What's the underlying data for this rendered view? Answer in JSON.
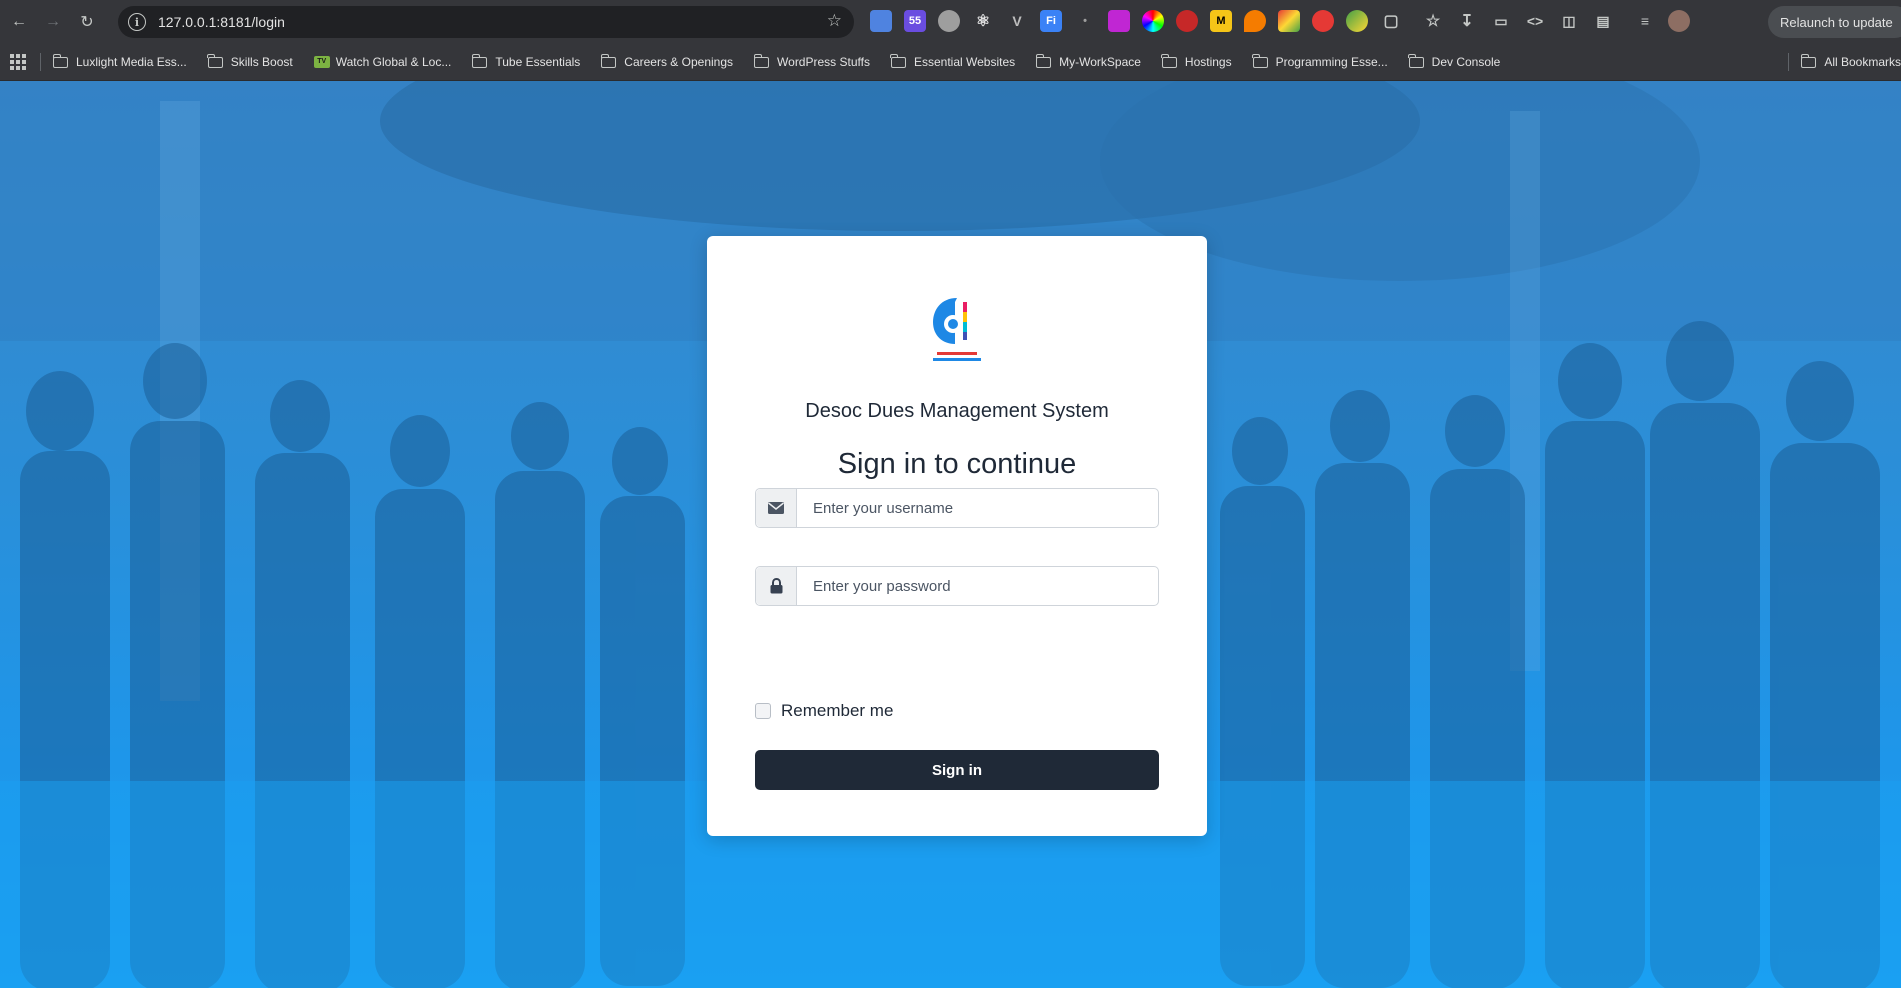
{
  "browser": {
    "url": "127.0.0.1:8181/login",
    "relaunch_label": "Relaunch to update",
    "extensions": [
      "doc-ext",
      "ss-ext",
      "ghost-ext",
      "react-ext",
      "vue-ext",
      "fi-ext",
      "ai-ext",
      "toggl-ext",
      "color-ext",
      "fox-ext",
      "md-ext",
      "fire-ext",
      "palette-ext",
      "adblock-ext",
      "graph-ext",
      "puzzle-ext"
    ],
    "bookmarks": [
      {
        "label": "Luxlight Media Ess...",
        "icon": "folder-icon"
      },
      {
        "label": "Skills Boost",
        "icon": "folder-icon"
      },
      {
        "label": "Watch Global & Loc...",
        "icon": "tv-icon"
      },
      {
        "label": "Tube Essentials",
        "icon": "folder-icon"
      },
      {
        "label": "Careers & Openings",
        "icon": "folder-icon"
      },
      {
        "label": "WordPress Stuffs",
        "icon": "folder-icon"
      },
      {
        "label": "Essential Websites",
        "icon": "folder-icon"
      },
      {
        "label": "My-WorkSpace",
        "icon": "folder-icon"
      },
      {
        "label": "Hostings",
        "icon": "folder-icon"
      },
      {
        "label": "Programming Esse...",
        "icon": "folder-icon"
      },
      {
        "label": "Dev Console",
        "icon": "folder-icon"
      }
    ],
    "all_bookmarks_label": "All Bookmarks"
  },
  "login": {
    "system_name": "Desoc Dues Management System",
    "title": "Sign in to continue",
    "username_placeholder": "Enter your username",
    "password_placeholder": "Enter your password",
    "remember_label": "Remember me",
    "submit_label": "Sign in"
  },
  "colors": {
    "page_overlay": "#1e96ea",
    "button": "#1f2937",
    "card": "#ffffff"
  }
}
